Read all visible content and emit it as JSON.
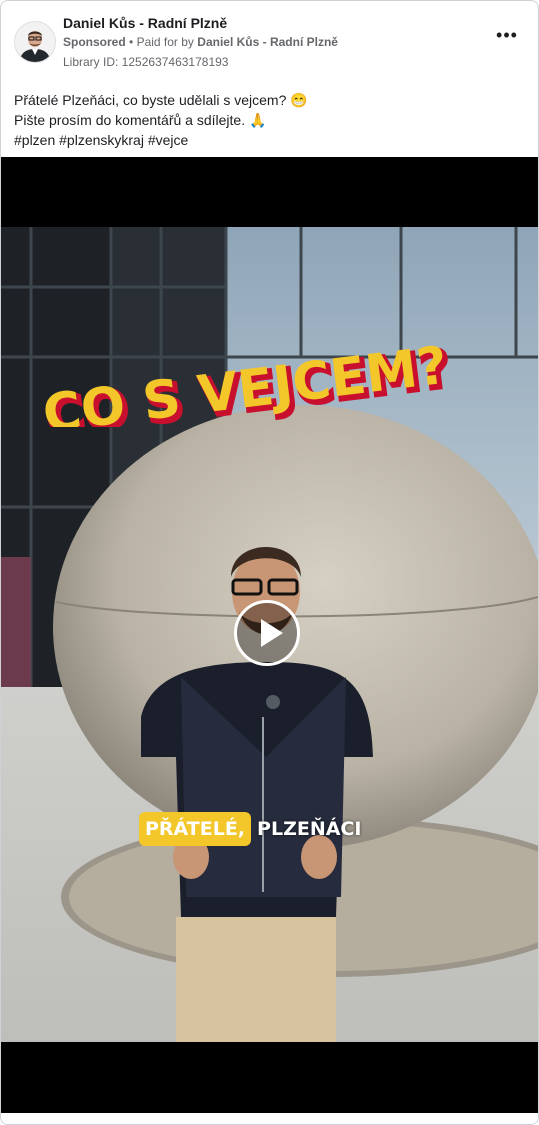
{
  "ad": {
    "page_name": "Daniel Kůs - Radní Plzně",
    "sponsored_label": "Sponsored",
    "paid_for_prefix": "Paid for by",
    "paid_for_name": "Daniel Kůs - Radní Plzně",
    "library_id": "Library ID: 1252637463178193",
    "more_icon": "more-options-icon"
  },
  "caption": {
    "line1": "Přátelé Plzeňáci, co byste udělali s vejcem? 😁",
    "line2": "Pište prosím do komentářů a sdílejte. 🙏",
    "line3": "#plzen #plzenskykraj #vejce"
  },
  "video": {
    "title_overlay": "CO S VEJCEM?",
    "subtitle_highlight": "PŘÁTELÉ,",
    "subtitle_rest": "PLZEŇÁCI",
    "play_icon": "play-icon"
  },
  "colors": {
    "title_fill": "#f3c62a",
    "title_shadow": "#c8102e",
    "subtitle_highlight": "#f3c62a",
    "border": "#cfd1d4",
    "meta_text": "#65676b"
  }
}
